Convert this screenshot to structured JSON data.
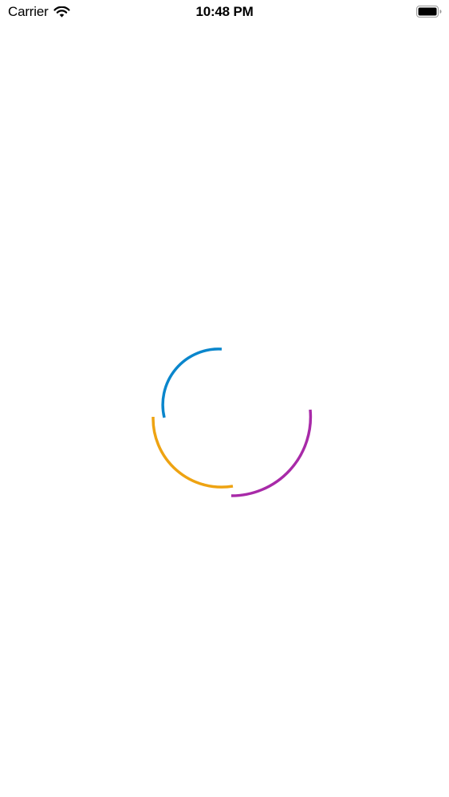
{
  "status_bar": {
    "carrier": "Carrier",
    "time": "10:48 PM",
    "icons": [
      "wifi-icon",
      "battery-icon"
    ]
  },
  "spinner": {
    "arcs": [
      {
        "name": "blue",
        "color": "#0A86CC"
      },
      {
        "name": "orange",
        "color": "#EEA312"
      },
      {
        "name": "magenta",
        "color": "#A82AA8"
      }
    ]
  }
}
